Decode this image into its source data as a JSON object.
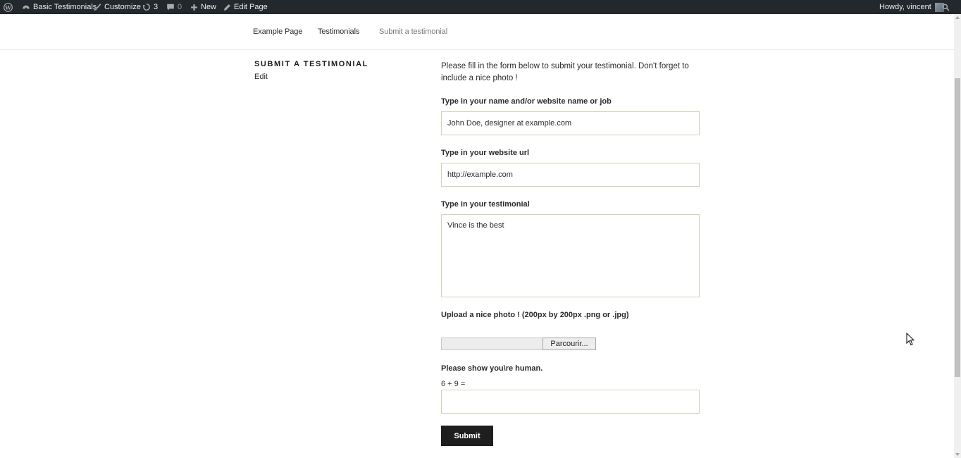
{
  "adminbar": {
    "site_name": "Basic Testimonials",
    "customize": "Customize",
    "updates_count": "3",
    "comments_count": "0",
    "new": "New",
    "edit_page": "Edit Page",
    "howdy": "Howdy, vincent"
  },
  "nav": {
    "items": [
      "Example Page",
      "Testimonials",
      "Submit a testimonial"
    ],
    "current_index": 2
  },
  "page": {
    "title": "Submit a testimonial",
    "edit": "Edit"
  },
  "form": {
    "intro": "Please fill in the form below to submit your testimonial. Don't forget to include a nice photo !",
    "name_label": "Type in your name and/or website name or job",
    "name_value": "John Doe, designer at example.com",
    "url_label": "Type in your website url",
    "url_value": "http://example.com",
    "testimonial_label": "Type in your testimonial",
    "testimonial_value": "Vince is the best",
    "photo_label": "Upload a nice photo ! (200px by 200px .png or .jpg)",
    "browse_button": "Parcourir...",
    "human_label": "Please show you\\re human.",
    "captcha_question": "6 + 9 =",
    "captcha_value": "",
    "submit": "Submit"
  },
  "colors": {
    "adminbar_bg": "#23282d",
    "button_bg": "#1e1e1e",
    "input_border": "#d4d0ba"
  }
}
